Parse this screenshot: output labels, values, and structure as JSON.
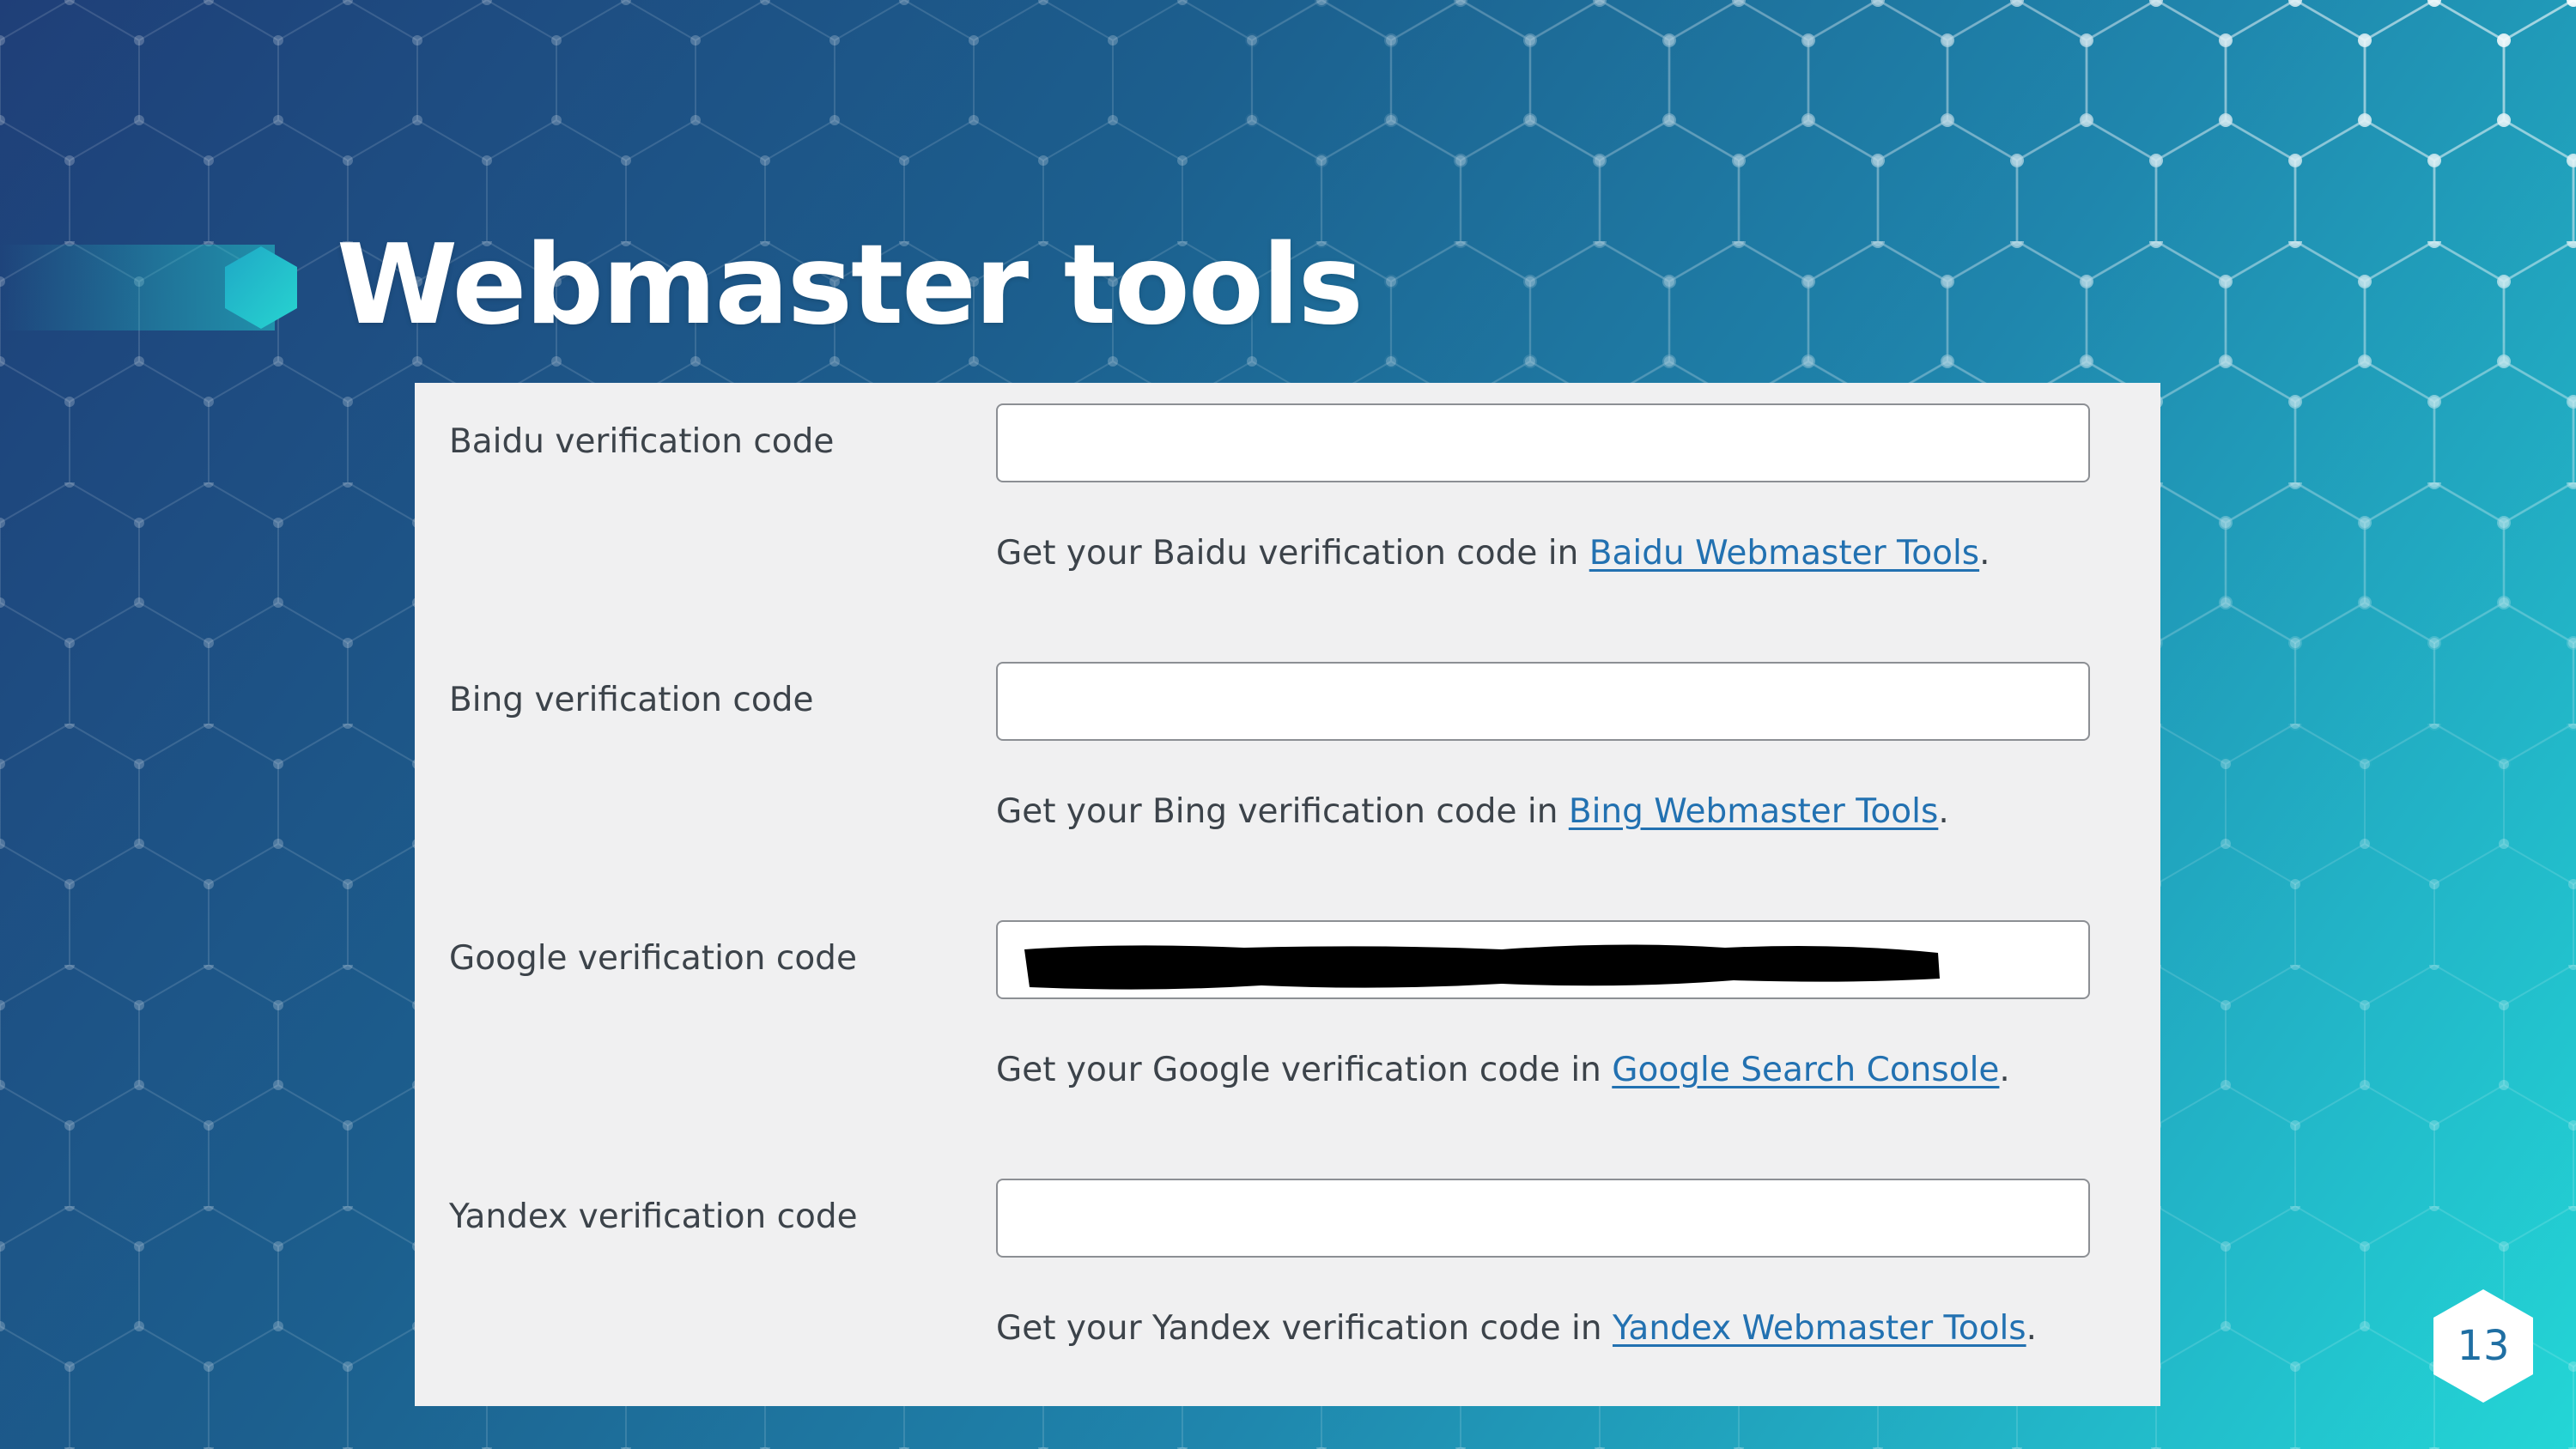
{
  "slide": {
    "title": "Webmaster tools",
    "page_number": "13"
  },
  "colors": {
    "label_text": "#3c434a",
    "link": "#2271b1",
    "panel_bg": "#f0f0f1",
    "accent_hex": "#23c6c8"
  },
  "fields": [
    {
      "label": "Baidu verification code",
      "value": "",
      "desc_prefix": "Get your Baidu verification code in ",
      "link_text": "Baidu Webmaster Tools",
      "desc_suffix": "."
    },
    {
      "label": "Bing verification code",
      "value": "",
      "desc_prefix": "Get your Bing verification code in ",
      "link_text": "Bing Webmaster Tools",
      "desc_suffix": "."
    },
    {
      "label": "Google verification code",
      "value": "",
      "redacted": true,
      "desc_prefix": "Get your Google verification code in ",
      "link_text": "Google Search Console",
      "desc_suffix": "."
    },
    {
      "label": "Yandex verification code",
      "value": "",
      "desc_prefix": "Get your Yandex verification code in ",
      "link_text": "Yandex Webmaster Tools",
      "desc_suffix": "."
    }
  ]
}
